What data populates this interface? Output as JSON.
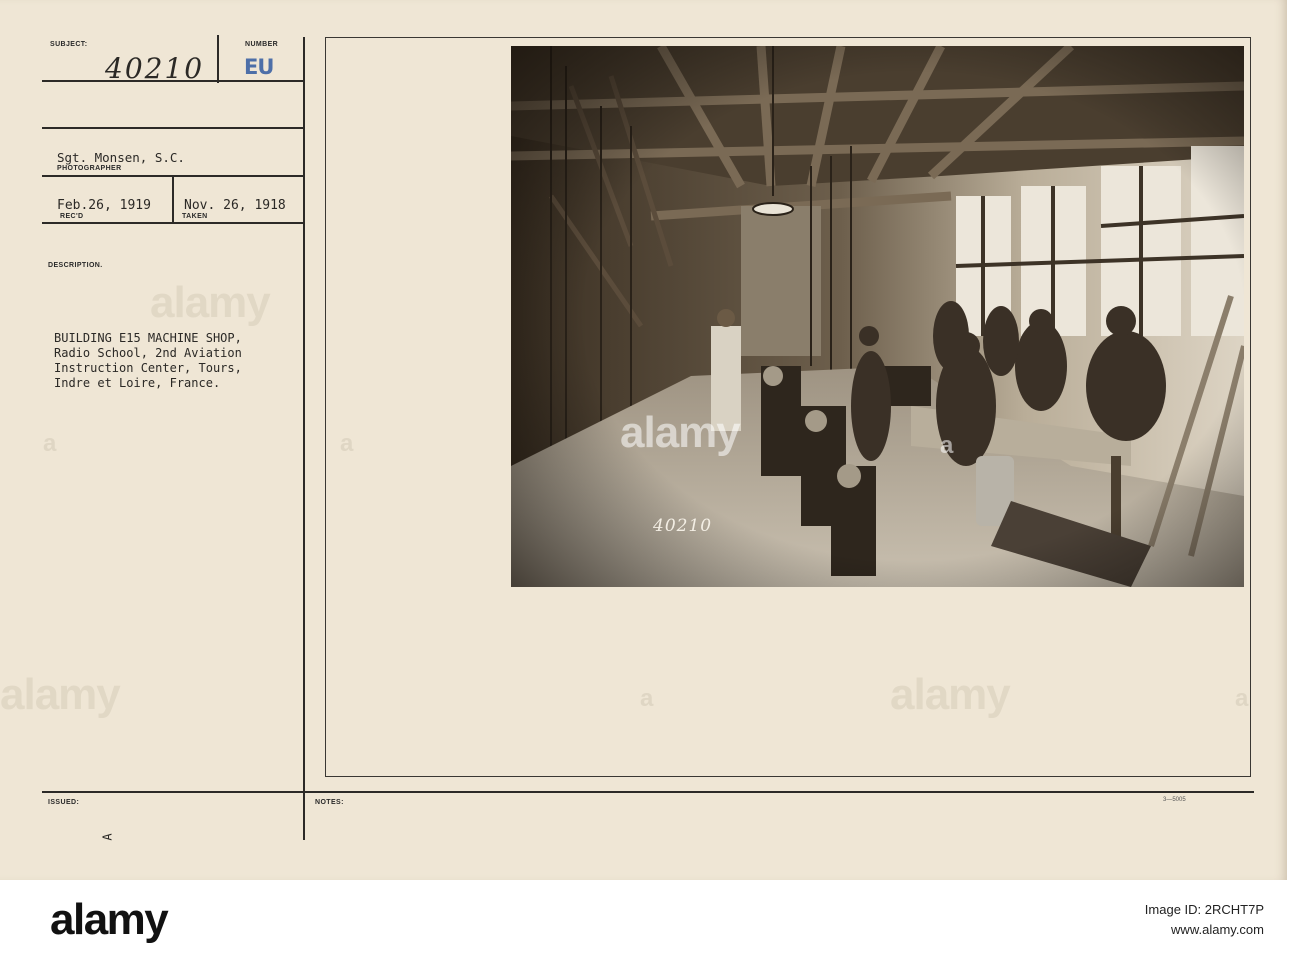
{
  "card": {
    "labels": {
      "subject": "SUBJECT:",
      "number": "NUMBER",
      "photographer": "PHOTOGRAPHER",
      "recd": "REC'D",
      "taken": "TAKEN",
      "description": "DESCRIPTION.",
      "issued": "ISSUED:",
      "notes": "NOTES:"
    },
    "subject_number": "40210",
    "number_stamp": "EU",
    "photographer": "Sgt. Monsen, S.C.",
    "received_date": "Feb.26, 1919",
    "taken_date": "Nov. 26, 1918",
    "description_lines": [
      "BUILDING E15 MACHINE SHOP,",
      "Radio School, 2nd Aviation",
      "Instruction Center, Tours,",
      "Indre et Loire, France."
    ],
    "photo_number": "40210",
    "form_code": "3—5005",
    "margin_mark": "A"
  },
  "watermark": "alamy",
  "footer": {
    "logo": "alamy",
    "image_id": "Image ID: 2RCHT7P",
    "site": "www.alamy.com"
  }
}
